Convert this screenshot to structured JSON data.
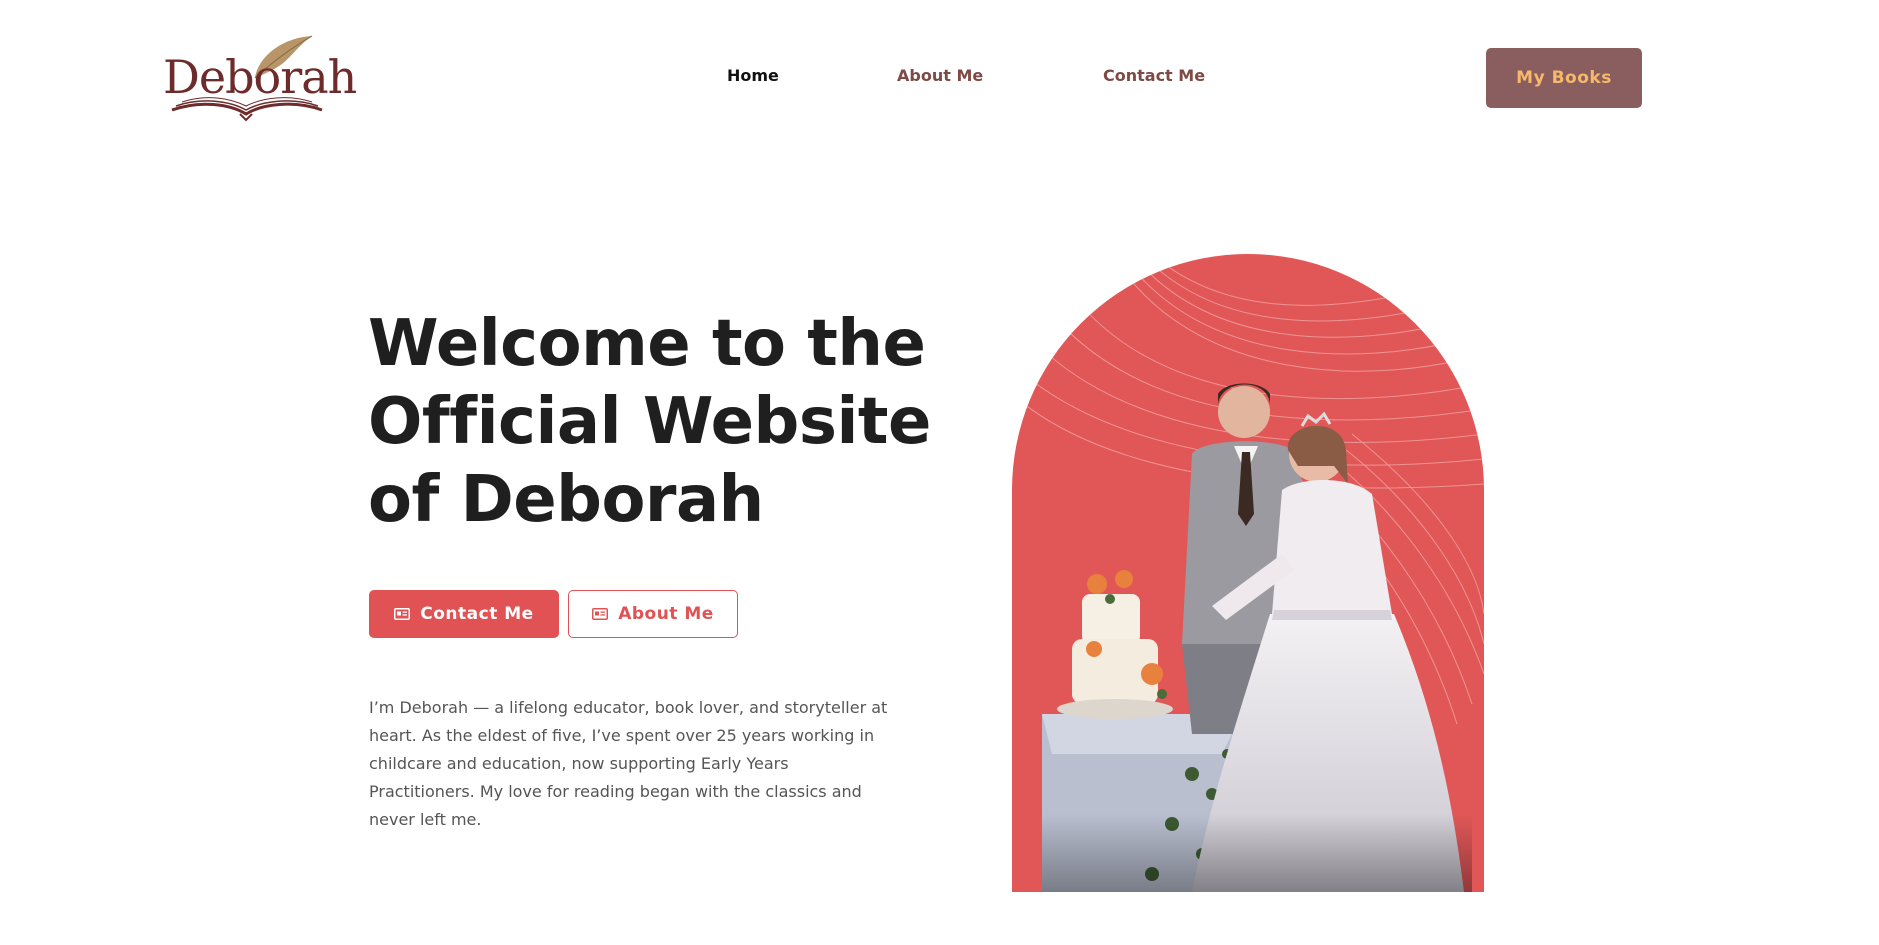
{
  "header": {
    "logo_text": "Deborah",
    "nav": {
      "home": "Home",
      "about": "About Me",
      "contact": "Contact Me"
    },
    "cta": "My Books"
  },
  "hero": {
    "title": "Welcome to the Official Website of Deborah",
    "buttons": {
      "contact": "Contact Me",
      "about": "About Me"
    },
    "description": "I’m Deborah — a lifelong educator, book lover, and storyteller at heart. As the eldest of five, I’ve spent over 25 years working in childcare and education, now supporting Early Years Practitioners. My love for reading began with the classics and never left me."
  },
  "image": {
    "subject": "wedding couple cutting cake"
  },
  "colors": {
    "accent": "#e05253",
    "brand_dark": "#6e2b2b",
    "cta_bg": "#8a5e5e",
    "cta_text": "#f6b96a",
    "arch_bg": "#e15757"
  },
  "icons": [
    "quill-feather-icon",
    "open-book-icon",
    "id-card-icon"
  ]
}
